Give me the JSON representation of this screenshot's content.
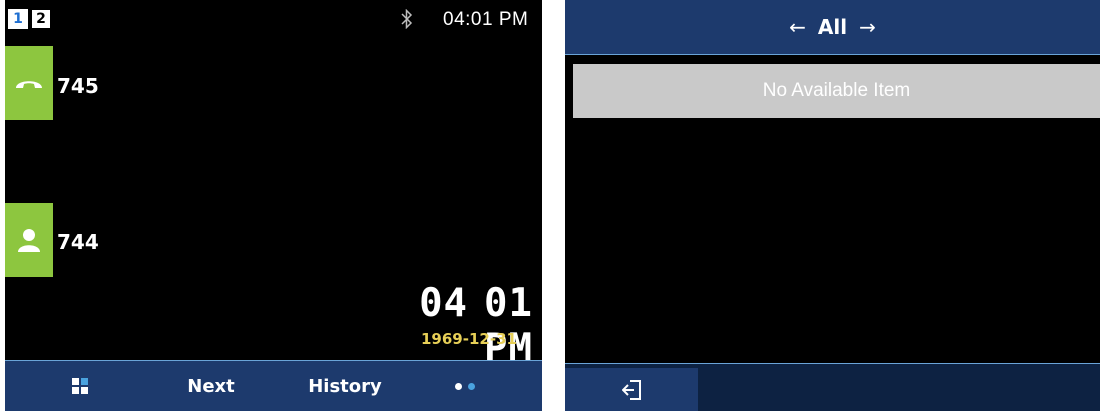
{
  "left_screen": {
    "pages": [
      "1",
      "2"
    ],
    "status": {
      "time": "04:01 PM",
      "bluetooth_icon": "bluetooth-icon"
    },
    "line_keys": [
      {
        "label": "745",
        "icon": "phone-handset-icon"
      },
      {
        "label": "744",
        "icon": "contact-person-icon"
      }
    ],
    "clock": {
      "hour": "04",
      "minute": "01",
      "ampm": "PM",
      "date": "1969-12-31"
    },
    "softkeys": {
      "menu_icon": "menu-grid-icon",
      "next": "Next",
      "history": "History",
      "more_icon": "more-dots-icon"
    },
    "colors": {
      "line_key_bg": "#8dc63f",
      "date": "#e7cf57",
      "softbar": "#1d3a6d",
      "page_active": "#1f6fd1"
    }
  },
  "right_screen": {
    "header": {
      "left_arrow": "←",
      "title": "All",
      "right_arrow": "→"
    },
    "empty_message": "No Available Item",
    "softkeys": {
      "exit_icon": "exit-icon"
    },
    "colors": {
      "header": "#1d3a6d",
      "item_bg": "#c9c9c9",
      "softbar": "#0d2242"
    }
  }
}
